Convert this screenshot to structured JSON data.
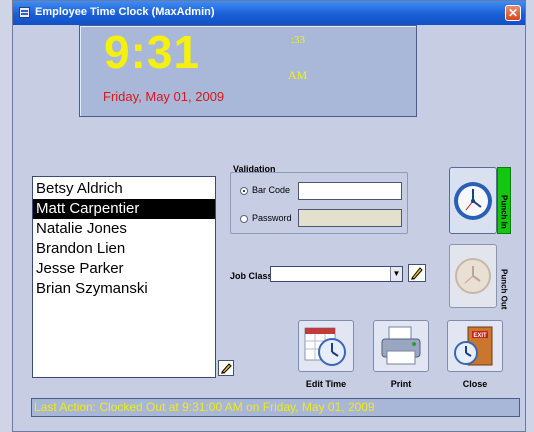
{
  "window": {
    "title": "Employee Time Clock  (MaxAdmin)",
    "close_glyph": "✕"
  },
  "clock": {
    "time": "9:31",
    "seconds": ":33",
    "ampm": "AM",
    "date": "Friday, May 01, 2009"
  },
  "employees": [
    "Betsy Aldrich",
    "Matt Carpentier",
    "Natalie Jones",
    "Brandon Lien",
    "Jesse Parker",
    "Brian Szymanski"
  ],
  "selected_employee": "Matt Carpentier",
  "validation": {
    "title": "Validation",
    "bar_code_label": "Bar Code",
    "password_label": "Password",
    "selected": "Bar Code",
    "bar_code_value": "",
    "password_value": ""
  },
  "job_class": {
    "label": "Job Class",
    "value": ""
  },
  "punch": {
    "in_label": "Punch In",
    "out_label": "Punch Out"
  },
  "actions": {
    "edit_time": "Edit Time",
    "print": "Print",
    "close": "Close"
  },
  "status": "Last Action: Clocked Out at 9:31:00 AM on Friday, May 01, 2009",
  "colors": {
    "clock_digits": "#f4f10f",
    "date": "#d8161c",
    "punch_in_tab": "#13c60f",
    "status_text": "#f1ea16",
    "titlebar": "#1a5fd6"
  },
  "icons": [
    "window-app-icon",
    "close-icon",
    "pencil-icon",
    "clock-icon",
    "calendar-clock-icon",
    "printer-icon",
    "exit-door-icon"
  ]
}
